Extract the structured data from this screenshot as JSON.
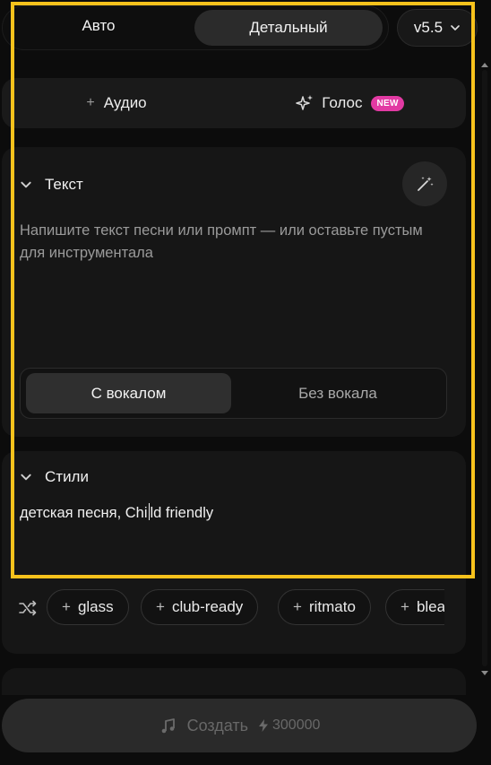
{
  "mode_tabs": {
    "auto": "Авто",
    "detailed": "Детальный"
  },
  "version": {
    "label": "v5.5"
  },
  "audio_button": {
    "label": "Аудио"
  },
  "voice_button": {
    "label": "Голос",
    "badge": "NEW"
  },
  "lyrics": {
    "title": "Текст",
    "placeholder": "Напишите текст песни или промпт — или оставьте пустым для инструментала",
    "vocal_options": [
      "С вокалом",
      "Без вокала"
    ],
    "selected_vocal": "С вокалом"
  },
  "styles": {
    "title": "Стили",
    "value_before_caret": "детская песня, Chi",
    "value_after_caret": "ld friendly",
    "tags": [
      {
        "label": "glass"
      },
      {
        "label": "club-ready"
      },
      {
        "label": "ritmato"
      },
      {
        "label": "bleak"
      }
    ]
  },
  "create_button": {
    "label": "Создать",
    "credits": "300000"
  },
  "colors": {
    "highlight": "#f7c21c",
    "new_badge": "#e23aa3"
  },
  "icons": [
    "chevron-down-icon",
    "plus-icon",
    "sparkle-voice-icon",
    "magic-wand-icon",
    "shuffle-icon",
    "music-note-icon",
    "lightning-icon"
  ]
}
